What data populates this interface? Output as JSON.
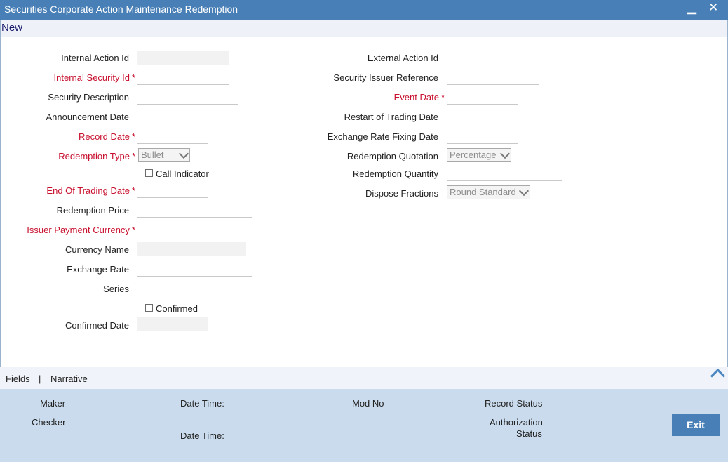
{
  "window": {
    "title": "Securities Corporate Action Maintenance Redemption",
    "minimize": "▁",
    "close": "✕"
  },
  "toolbar": {
    "new_label": "New"
  },
  "left": {
    "internal_action_id": {
      "label": "Internal Action Id",
      "value": ""
    },
    "internal_security_id": {
      "label": "Internal Security Id",
      "value": ""
    },
    "security_description": {
      "label": "Security Description",
      "value": ""
    },
    "announcement_date": {
      "label": "Announcement Date",
      "value": ""
    },
    "record_date": {
      "label": "Record Date",
      "value": ""
    },
    "redemption_type": {
      "label": "Redemption Type",
      "value": "Bullet"
    },
    "call_indicator": {
      "label": "Call Indicator",
      "checked": false
    },
    "end_of_trading_date": {
      "label": "End Of Trading Date",
      "value": ""
    },
    "redemption_price": {
      "label": "Redemption Price",
      "value": ""
    },
    "issuer_payment_currency": {
      "label": "Issuer Payment Currency",
      "value": ""
    },
    "currency_name": {
      "label": "Currency Name",
      "value": ""
    },
    "exchange_rate": {
      "label": "Exchange Rate",
      "value": ""
    },
    "series": {
      "label": "Series",
      "value": ""
    },
    "confirmed": {
      "label": "Confirmed",
      "checked": false
    },
    "confirmed_date": {
      "label": "Confirmed Date",
      "value": ""
    }
  },
  "right": {
    "external_action_id": {
      "label": "External Action Id",
      "value": ""
    },
    "security_issuer_reference": {
      "label": "Security Issuer Reference",
      "value": ""
    },
    "event_date": {
      "label": "Event Date",
      "value": ""
    },
    "restart_of_trading_date": {
      "label": "Restart of Trading Date",
      "value": ""
    },
    "exchange_rate_fixing_date": {
      "label": "Exchange Rate Fixing Date",
      "value": ""
    },
    "redemption_quotation": {
      "label": "Redemption Quotation",
      "value": "Percentage"
    },
    "redemption_quantity": {
      "label": "Redemption Quantity",
      "value": ""
    },
    "dispose_fractions": {
      "label": "Dispose Fractions",
      "value": "Round Standard"
    }
  },
  "required_marker": "*",
  "tabs": {
    "fields": "Fields",
    "separator": "|",
    "narrative": "Narrative"
  },
  "footer": {
    "maker": "Maker",
    "checker": "Checker",
    "date_time_1": "Date Time:",
    "date_time_2": "Date Time:",
    "mod_no": "Mod No",
    "record_status": "Record Status",
    "authorization_status_1": "Authorization",
    "authorization_status_2": "Status",
    "exit_label": "Exit"
  },
  "colors": {
    "title_bar": "#477fb6",
    "required": "#c8102e",
    "footer": "#c9dbec"
  }
}
